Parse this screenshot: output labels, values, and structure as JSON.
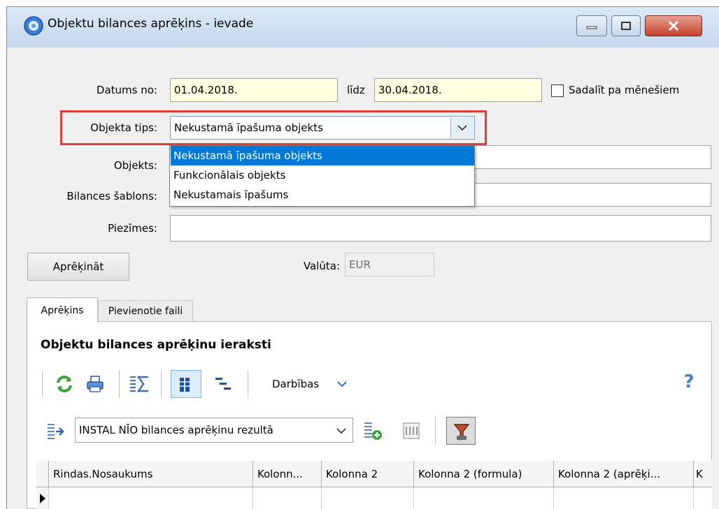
{
  "window": {
    "title": "Objektu bilances aprēķins - ievade"
  },
  "form": {
    "date_from_label": "Datums no:",
    "date_from_value": "01.04.2018.",
    "date_to_label": "līdz",
    "date_to_value": "30.04.2018.",
    "split_months_label": "Sadalīt pa mēnešiem",
    "object_type_label": "Objekta tips:",
    "object_type_value": "Nekustamā īpašuma objekts",
    "object_label": "Objekts:",
    "balance_template_label": "Bilances šablons:",
    "notes_label": "Piezīmes:",
    "notes_value": "",
    "calculate_button": "Aprēķināt",
    "currency_label": "Valūta:",
    "currency_value": "EUR"
  },
  "dropdown": {
    "options": [
      "Nekustamā īpašuma objekts",
      "Funkcionālais objekts",
      "Nekustamais īpašums"
    ],
    "selected_index": 0
  },
  "tabs": [
    "Aprēķins",
    "Pievienotie faili"
  ],
  "panel": {
    "title": "Objektu bilances aprēķinu ieraksti",
    "actions_label": "Darbības",
    "help_glyph": "?",
    "report_select_value": "INSTAL NĪO bilances aprēķinu rezultā"
  },
  "grid": {
    "columns": [
      "Rindas.Nosaukums",
      "Kolonn...",
      "Kolonna 2",
      "Kolonna 2 (formula)",
      "Kolonna 2 (aprēķi...",
      "K"
    ]
  },
  "colors": {
    "highlight_border": "#e03c3c",
    "selection": "#0078d7",
    "required_field": "#ffffe1"
  },
  "icons": [
    "app-icon",
    "minimize-icon",
    "maximize-icon",
    "close-icon",
    "dropdown-arrow-icon",
    "refresh-icon",
    "print-icon",
    "sum-icon",
    "columns-icon",
    "tree-icon",
    "help-icon",
    "move-icon",
    "add-report-icon",
    "list-icon",
    "filter-icon",
    "row-pointer-icon"
  ]
}
